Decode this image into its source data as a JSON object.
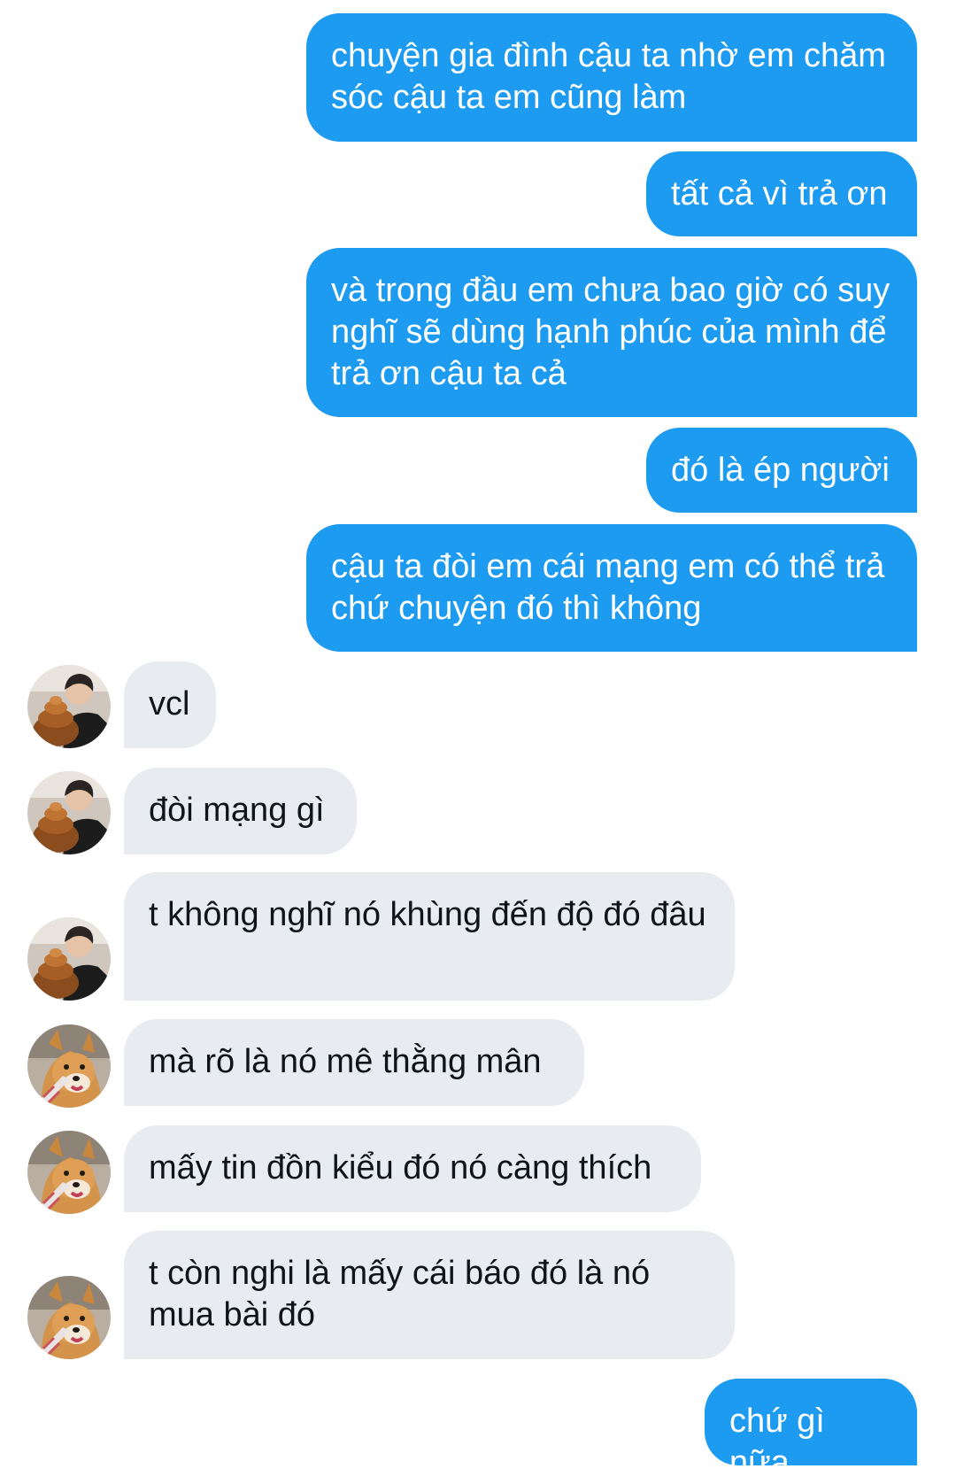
{
  "colors": {
    "outgoing_bubble": "#1d9bf0",
    "incoming_bubble": "#e8ecf0",
    "outgoing_text": "#ffffff",
    "incoming_text": "#0f1419"
  },
  "messages": [
    {
      "direction": "outgoing",
      "text": "chuyện gia đình cậu ta nhờ em chăm sóc cậu ta em cũng làm"
    },
    {
      "direction": "outgoing",
      "text": "tất cả vì trả ơn"
    },
    {
      "direction": "outgoing",
      "text": "và trong đầu em chưa bao giờ có suy nghĩ sẽ dùng hạnh phúc của mình để trả ơn cậu ta cả"
    },
    {
      "direction": "outgoing",
      "text": "đó là ép người"
    },
    {
      "direction": "outgoing",
      "text": "cậu ta đòi em cái mạng em có thể trả chứ chuyện đó thì không"
    },
    {
      "direction": "incoming",
      "avatar": "person-photo-avatar",
      "text": "vcl"
    },
    {
      "direction": "incoming",
      "avatar": "person-photo-avatar",
      "text": "đòi mạng gì"
    },
    {
      "direction": "incoming",
      "avatar": "person-photo-avatar",
      "text": "t không nghĩ nó khùng đến độ đó đâu"
    },
    {
      "direction": "incoming",
      "avatar": "shiba-dog-avatar",
      "text": "mà rõ là nó mê thằng mân"
    },
    {
      "direction": "incoming",
      "avatar": "shiba-dog-avatar",
      "text": "mấy tin đồn kiểu đó nó càng thích"
    },
    {
      "direction": "incoming",
      "avatar": "shiba-dog-avatar",
      "text": "t còn nghi là mấy cái báo đó là nó mua bài đó"
    },
    {
      "direction": "outgoing",
      "text": "chứ gì nữa"
    }
  ]
}
